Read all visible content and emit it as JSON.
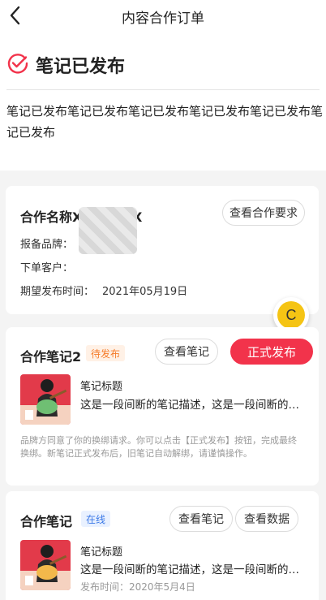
{
  "header": {
    "title": "内容合作订单",
    "back_icon": "chevron-left-icon"
  },
  "status": {
    "icon": "check-circle-icon",
    "title": "笔记已发布",
    "description": "笔记已发布笔记已发布笔记已发布笔记已发布笔记已发布笔记已发布",
    "accent_color": "#f2334b"
  },
  "cooperation": {
    "name": "合作名称XXXXXXX",
    "view_requirements_label": "查看合作要求",
    "brand_label": "报备品牌：",
    "customer_label": "下单客户：",
    "expected_date_label": "期望发布时间：",
    "expected_date_value": "2021年05月19日"
  },
  "note_card_pending": {
    "title": "合作笔记2",
    "tag": "待发布",
    "view_note_label": "查看笔记",
    "publish_label": "正式发布",
    "note_title": "笔记标题",
    "note_desc": "这是一段间断的笔记描述，这是一段间断的笔记描述",
    "hint": "品牌方同意了你的换绑请求。你可以点击【正式发布】按钮，完成最终换绑。新笔记正式发布后，旧笔记自动解绑，请谨慎操作。"
  },
  "note_card_online": {
    "title": "合作笔记",
    "tag": "在线",
    "view_note_label": "查看笔记",
    "view_data_label": "查看数据",
    "note_title": "笔记标题",
    "note_desc": "这是一段间断的笔记描述，这是一段间断的笔记描述",
    "publish_date": "发布时间：2020年5月4日"
  },
  "float_button": {
    "label": "C",
    "color": "#f5c414"
  }
}
